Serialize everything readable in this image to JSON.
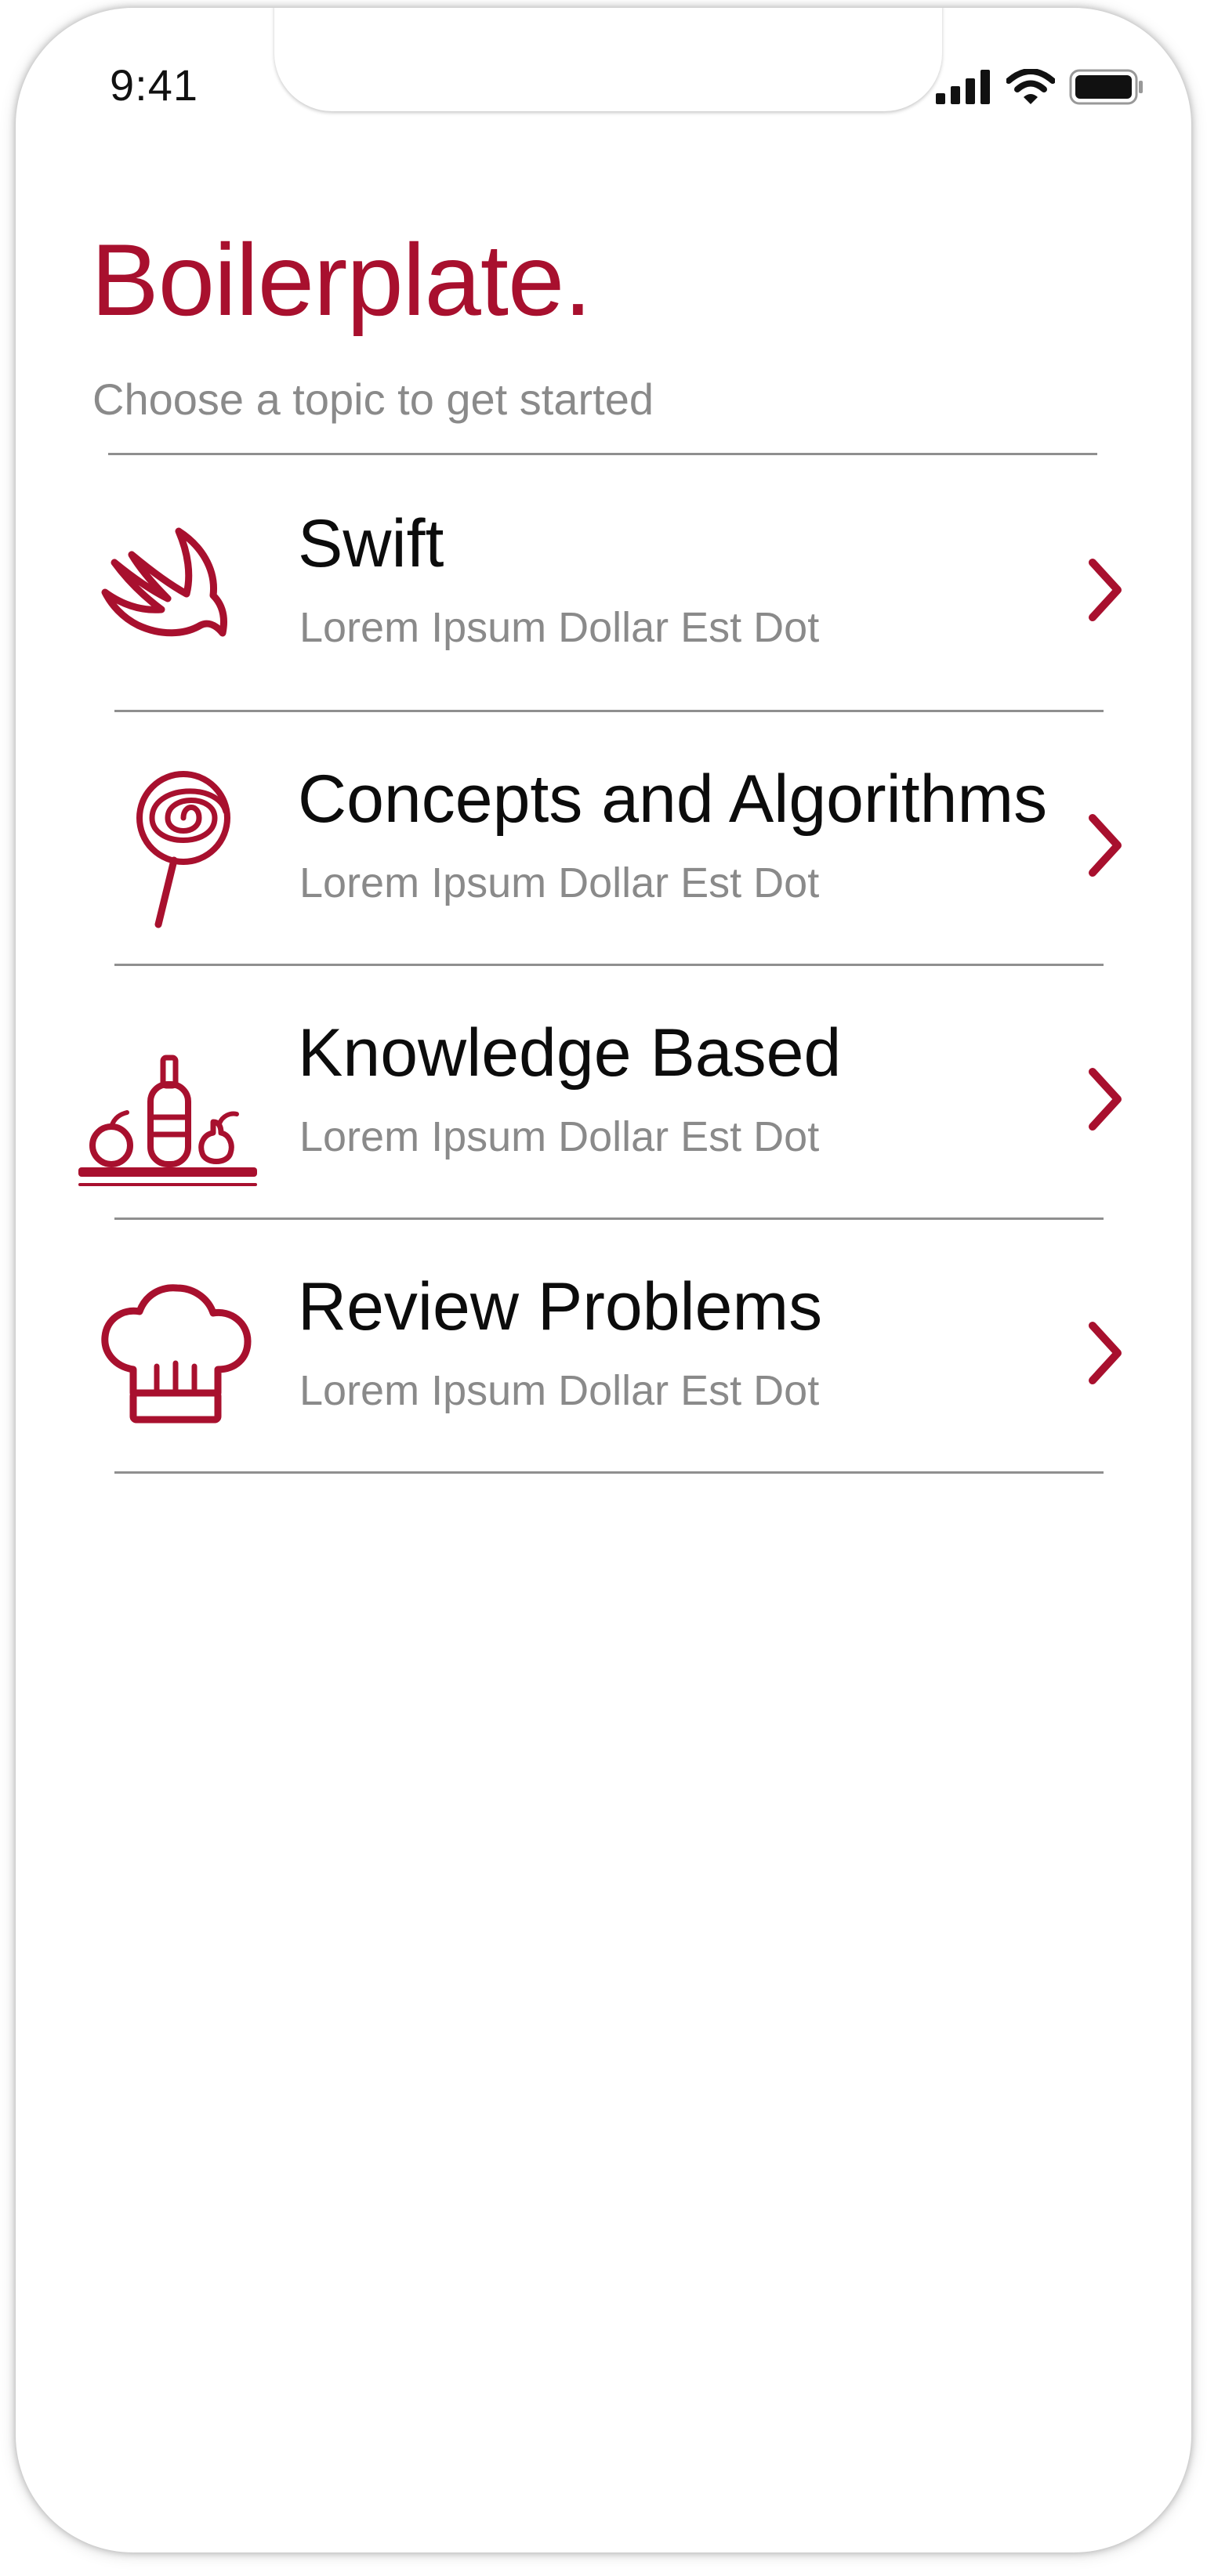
{
  "colors": {
    "accent": "#a8102e",
    "text": "#0c0c0c",
    "muted": "#8a8a8a",
    "divider": "#8f8f8f"
  },
  "status_bar": {
    "time": "9:41",
    "icons": [
      "signal-icon",
      "wifi-icon",
      "battery-icon"
    ]
  },
  "header": {
    "title": "Boilerplate.",
    "subtitle": "Choose a topic to get started"
  },
  "topics": [
    {
      "title": "Swift",
      "subtitle": "Lorem Ipsum Dollar Est Dot",
      "icon": "swift-bird-icon"
    },
    {
      "title": "Concepts and Algorithms",
      "subtitle": "Lorem Ipsum Dollar Est Dot",
      "icon": "lollipop-icon"
    },
    {
      "title": "Knowledge Based",
      "subtitle": "Lorem Ipsum Dollar Est Dot",
      "icon": "food-shelf-icon"
    },
    {
      "title": "Review Problems",
      "subtitle": "Lorem Ipsum Dollar Est Dot",
      "icon": "chef-hat-icon"
    }
  ]
}
